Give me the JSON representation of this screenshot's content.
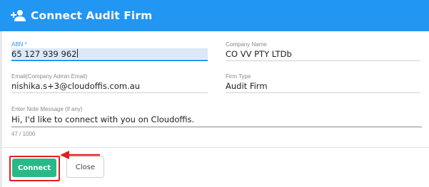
{
  "dialog": {
    "title": "Connect Audit Firm",
    "header_icon": "add-person-icon",
    "header_color": "#2196f3"
  },
  "fields": {
    "abn": {
      "label": "ABN *",
      "value": "65 127 939 962"
    },
    "company_name": {
      "label": "Company Name",
      "value": "CO VV PTY LTDb"
    },
    "email": {
      "label": "Email(Company Admin Email)",
      "value": "nishika.s+3@cloudoffis.com.au"
    },
    "firm_type": {
      "label": "Firm Type",
      "value": "Audit Firm"
    },
    "note": {
      "label": "Enter Note Message (if any)",
      "value": "Hi, I'd like to connect with you on Cloudoffis.",
      "counter": "47 / 1000"
    }
  },
  "actions": {
    "connect_label": "Connect",
    "close_label": "Close",
    "connect_color": "#29b989"
  },
  "annotation": {
    "highlight_color": "#e02020",
    "arrow_icon": "left-arrow-icon"
  }
}
